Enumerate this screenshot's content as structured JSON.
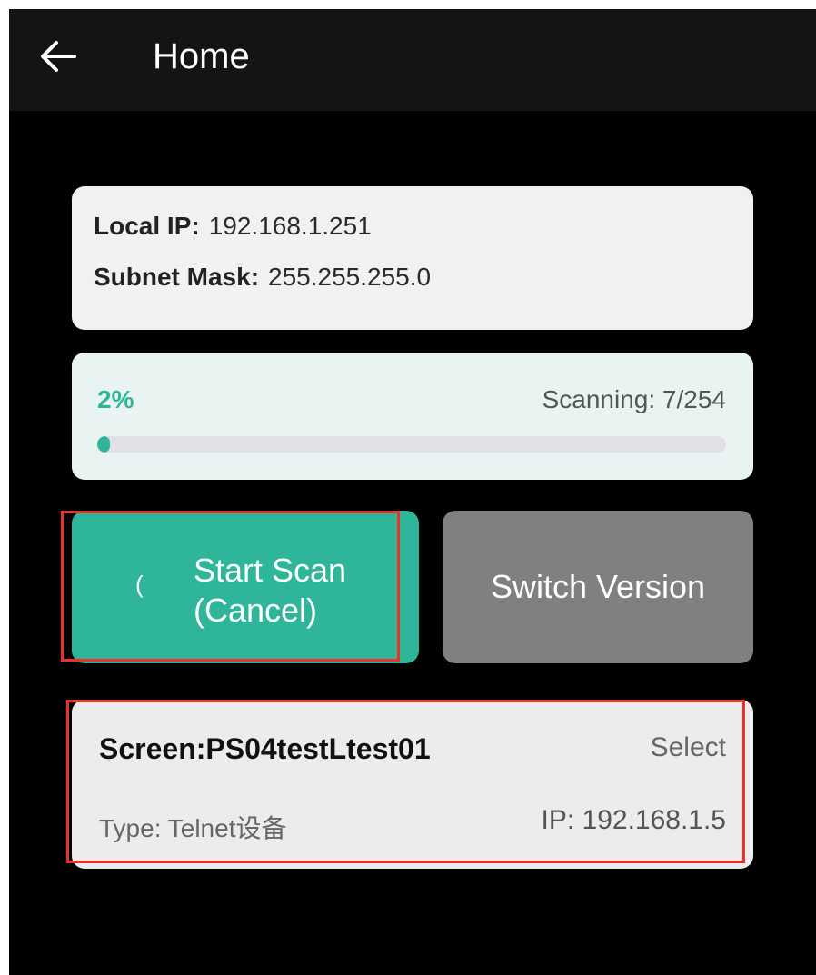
{
  "app_bar": {
    "back_icon": "arrow-left-icon",
    "title": "Home"
  },
  "network_info": {
    "local_ip_label": "Local IP:",
    "local_ip_value": "192.168.1.251",
    "subnet_mask_label": "Subnet Mask:",
    "subnet_mask_value": "255.255.255.0"
  },
  "scan_progress": {
    "percent_label": "2%",
    "percent_value": 0.02,
    "status_text": "Scanning: 7/254",
    "scanned": 7,
    "total": 254
  },
  "buttons": {
    "start_scan_line1": "Start Scan",
    "start_scan_line2": "(Cancel)",
    "spinner_icon": "loading-spinner-icon",
    "switch_version": "Switch Version"
  },
  "device": {
    "name": "Screen:PS04testLtest01",
    "select_label": "Select",
    "type_text": "Type: Telnet设备",
    "ip_text": "IP: 192.168.1.5"
  },
  "colors": {
    "accent": "#2fb59a",
    "background": "#000000",
    "app_bar": "#141414",
    "switch_button": "#808080",
    "highlight": "#e8322a"
  }
}
